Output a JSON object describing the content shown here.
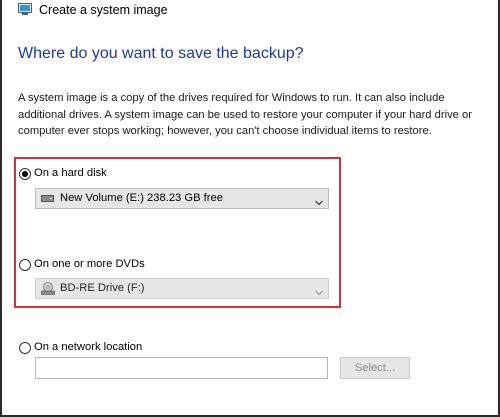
{
  "window": {
    "title": "Create a system image",
    "icon": "system-image-icon"
  },
  "page": {
    "heading": "Where do you want to save the backup?",
    "description": "A system image is a copy of the drives required for Windows to run. It can also include additional drives. A system image can be used to restore your computer if your hard drive or computer ever stops working; however, you can't choose individual items to restore."
  },
  "options": {
    "hard_disk": {
      "label": "On a hard disk",
      "selected": true,
      "dropdown_value": "New Volume (E:)  238.23 GB free",
      "dropdown_icon": "hard-drive-icon"
    },
    "dvd": {
      "label": "On one or more DVDs",
      "selected": false,
      "dropdown_value": "BD-RE Drive (F:)",
      "dropdown_icon": "dvd-drive-icon",
      "disabled": true
    },
    "network": {
      "label": "On a network location",
      "selected": false,
      "input_value": "",
      "select_button": "Select..."
    }
  },
  "colors": {
    "heading": "#1d3a9c",
    "highlight_border": "#d3313f"
  }
}
